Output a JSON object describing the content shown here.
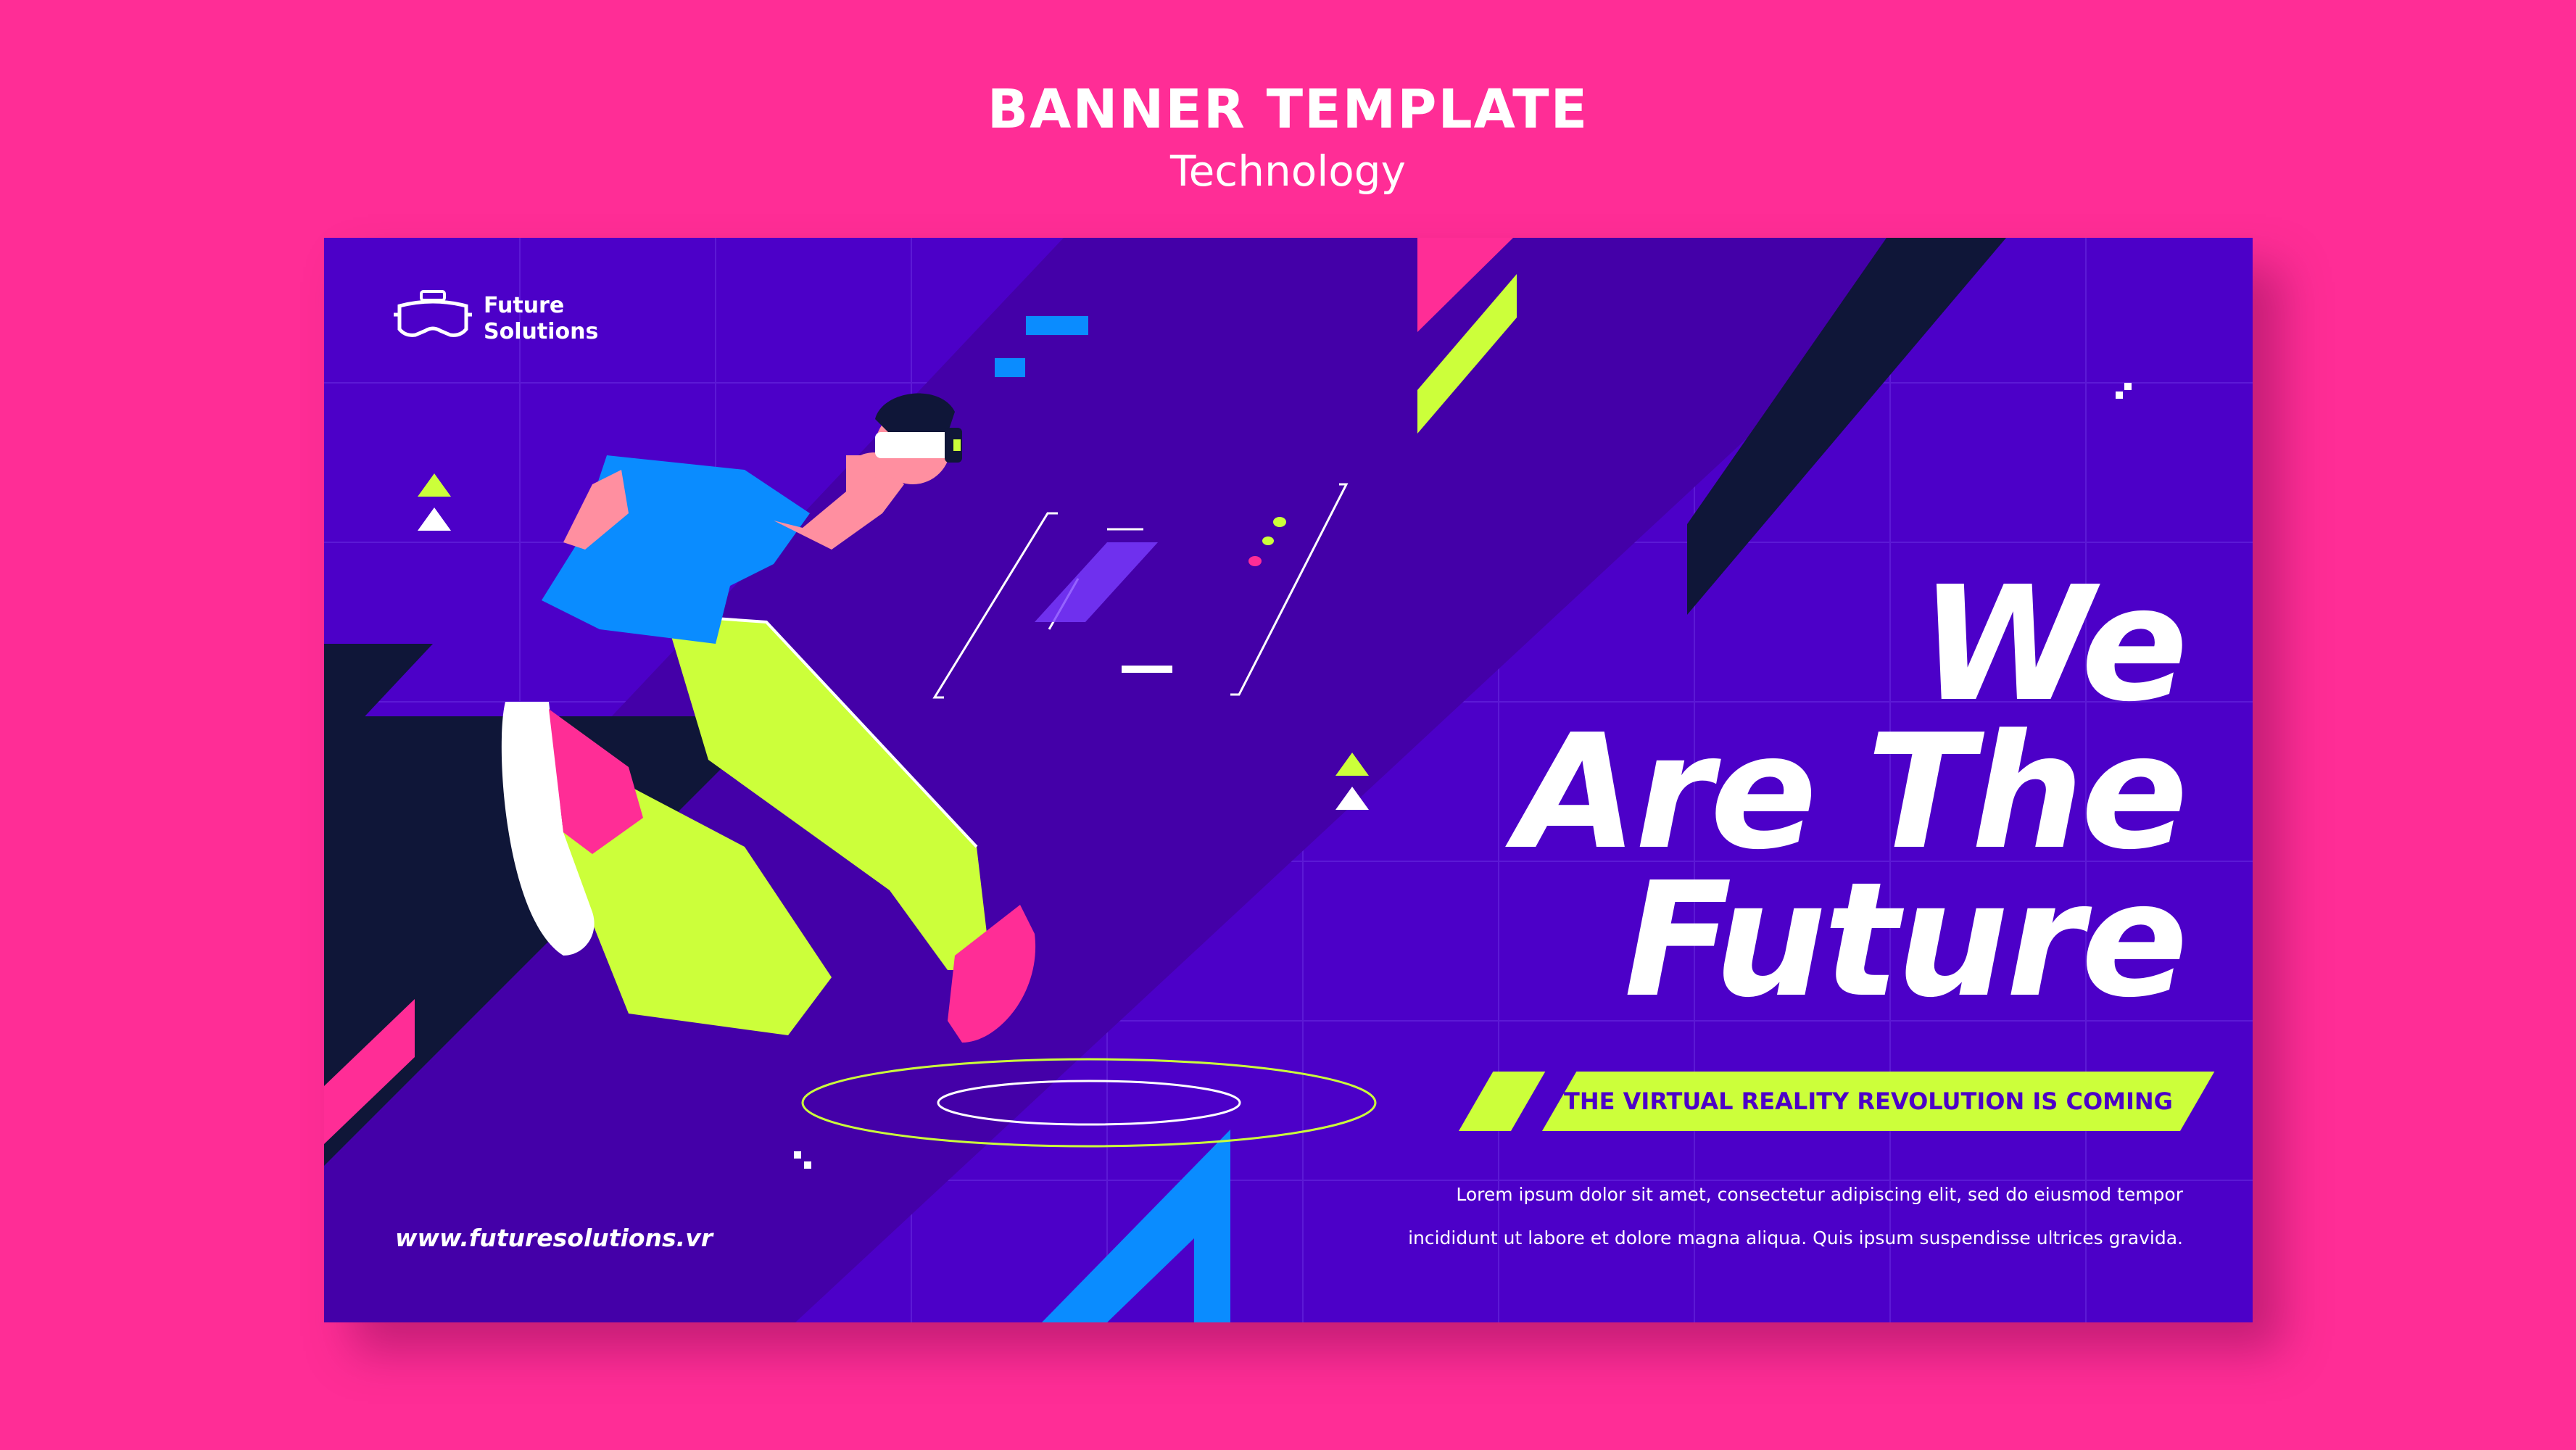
{
  "header": {
    "title": "BANNER TEMPLATE",
    "subtitle": "Technology"
  },
  "banner": {
    "logo": {
      "icon": "vr-headset-icon",
      "line1": "Future",
      "line2": "Solutions"
    },
    "headline": {
      "line1": "We",
      "line2": "Are The",
      "line3": "Future"
    },
    "tagline": "THE VIRTUAL REALITY REVOLUTION IS COMING",
    "body": {
      "line1": "Lorem ipsum dolor sit amet, consectetur adipiscing elit, sed do eiusmod tempor",
      "line2": "incididunt ut labore et dolore magna aliqua. Quis ipsum suspendisse ultrices gravida."
    },
    "website": "www.futuresolutions.vr",
    "illustration": "man-running-with-vr-headset"
  },
  "colors": {
    "background": "#ff2d96",
    "banner": "#4c00c8",
    "accent_lime": "#ccff3a",
    "accent_blue": "#0a8cff",
    "accent_pink": "#ff2d96",
    "dark": "#0f1638"
  }
}
